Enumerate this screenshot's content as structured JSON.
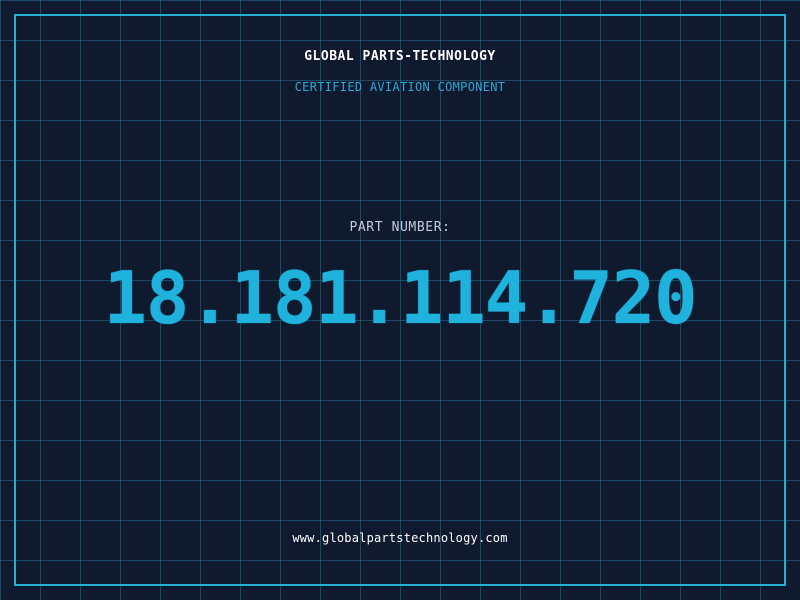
{
  "header": {
    "brand": "GLOBAL PARTS-TECHNOLOGY",
    "subtitle": "CERTIFIED AVIATION COMPONENT"
  },
  "main": {
    "part_label": "PART NUMBER:",
    "part_number": "18.181.114.720"
  },
  "footer": {
    "website": "www.globalpartstechnology.com"
  },
  "colors": {
    "background": "#101a2e",
    "grid": "#2882aa",
    "accent": "#1fb2dc",
    "frame": "#25b1d6",
    "label": "#c4ccd8",
    "text": "#ffffff"
  }
}
